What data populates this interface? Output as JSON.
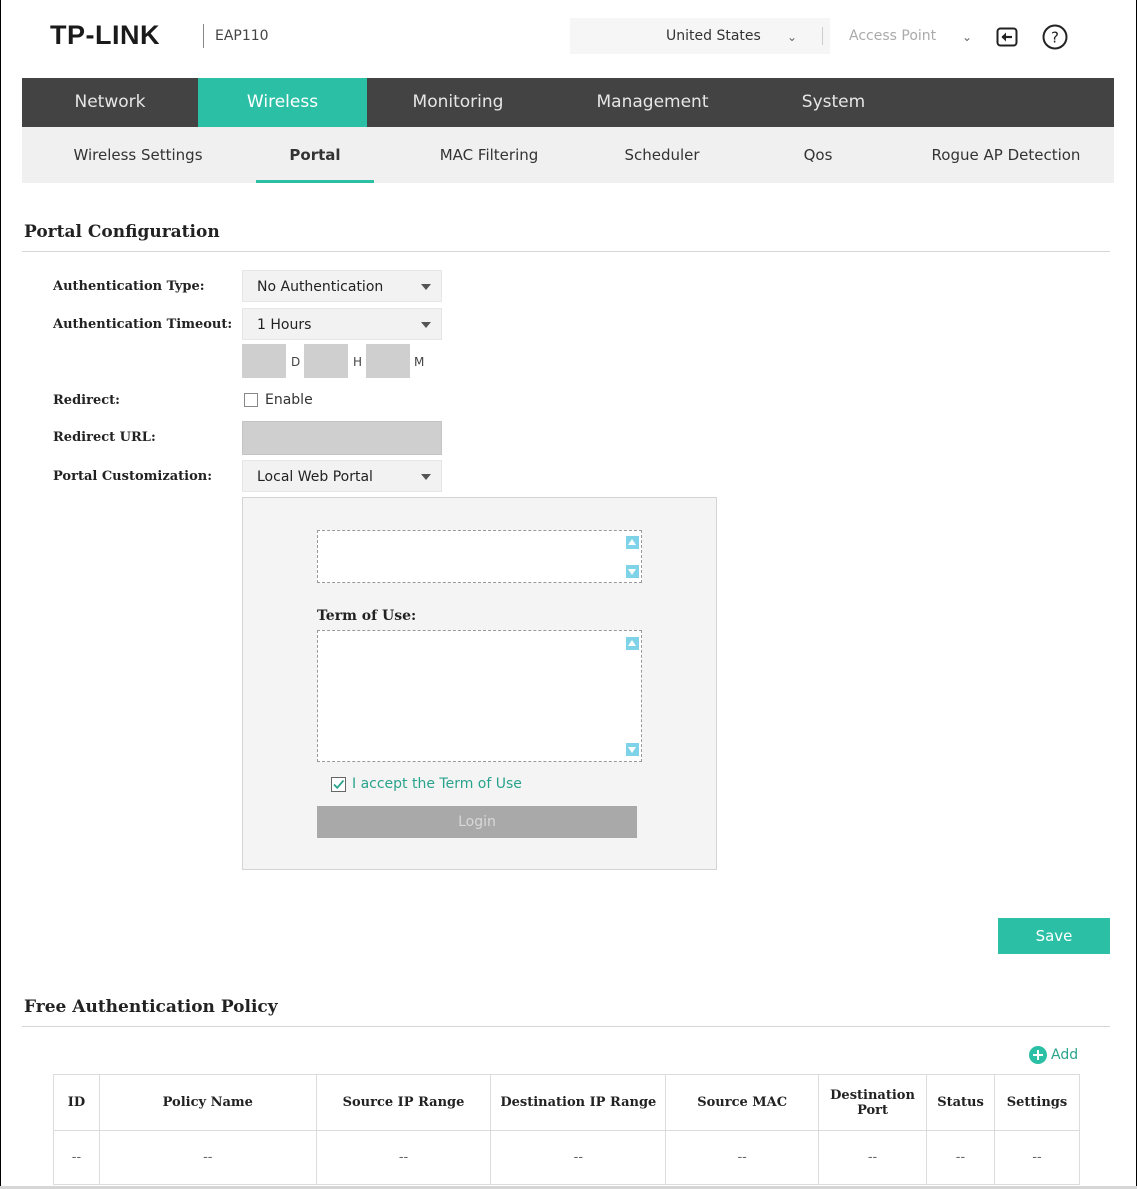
{
  "header": {
    "brand": "TP-LINK",
    "model": "EAP110",
    "region": "United States",
    "mode": "Access Point"
  },
  "nav": {
    "main": [
      "Network",
      "Wireless",
      "Monitoring",
      "Management",
      "System"
    ],
    "active_main": "Wireless",
    "sub": [
      "Wireless Settings",
      "Portal",
      "MAC Filtering",
      "Scheduler",
      "Qos",
      "Rogue AP Detection"
    ],
    "active_sub": "Portal"
  },
  "portal_config": {
    "title": "Portal Configuration",
    "auth_type_label": "Authentication Type:",
    "auth_type_value": "No Authentication",
    "auth_timeout_label": "Authentication Timeout:",
    "auth_timeout_value": "1 Hours",
    "unit_d": "D",
    "unit_h": "H",
    "unit_m": "M",
    "redirect_label": "Redirect:",
    "redirect_enable_label": "Enable",
    "redirect_enabled": false,
    "redirect_url_label": "Redirect URL:",
    "portal_custom_label": "Portal Customization:",
    "portal_custom_value": "Local Web Portal",
    "term_of_use_label": "Term of Use:",
    "accept_label": "I accept the Term of Use",
    "accept_checked": true,
    "login_label": "Login",
    "save_label": "Save"
  },
  "free_auth": {
    "title": "Free Authentication Policy",
    "add_label": "Add",
    "columns": [
      "ID",
      "Policy Name",
      "Source IP Range",
      "Destination IP Range",
      "Source MAC",
      "Destination Port",
      "Status",
      "Settings"
    ],
    "rows": [
      [
        "--",
        "--",
        "--",
        "--",
        "--",
        "--",
        "--",
        "--"
      ]
    ]
  },
  "colors": {
    "accent": "#2bbfa5",
    "nav_bg": "#434343",
    "subnav_bg": "#f0f0f0"
  }
}
